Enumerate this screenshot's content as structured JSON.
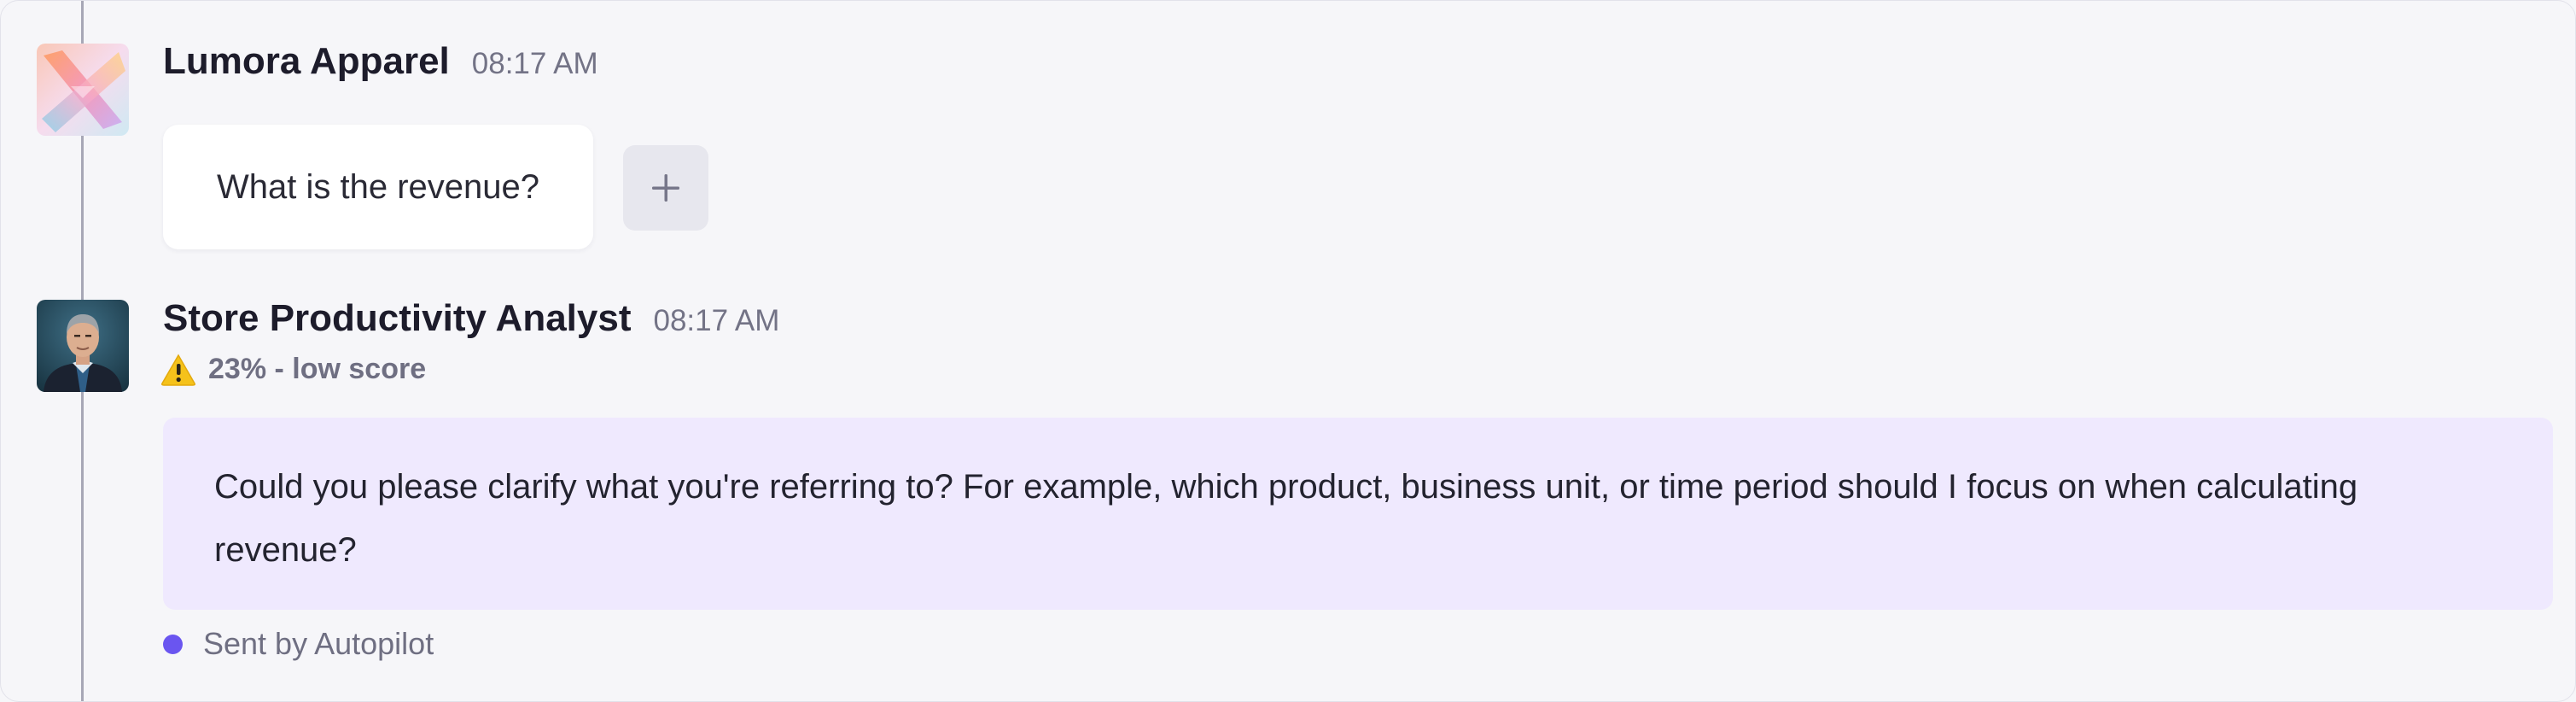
{
  "messages": [
    {
      "sender": "Lumora Apparel",
      "time": "08:17 AM",
      "text": "What is the revenue?",
      "avatar_icon": "brand-x-logo-icon",
      "action_icon": "plus-icon"
    },
    {
      "sender": "Store Productivity Analyst",
      "time": "08:17 AM",
      "score_icon": "warning-icon",
      "score_text": "23% - low score",
      "text": "Could you please clarify what you're referring to? For example, which product, business unit, or time period should I focus on when calculating revenue?",
      "footer_text": "Sent by Autopilot",
      "avatar_icon": "person-photo-avatar"
    }
  ],
  "colors": {
    "background": "#f6f6f9",
    "user_bubble": "#ffffff",
    "agent_bubble": "#efe9fe",
    "autopilot_dot": "#6a55f0",
    "warning": "#f5c21b",
    "thread_line": "#a7a7b6"
  }
}
